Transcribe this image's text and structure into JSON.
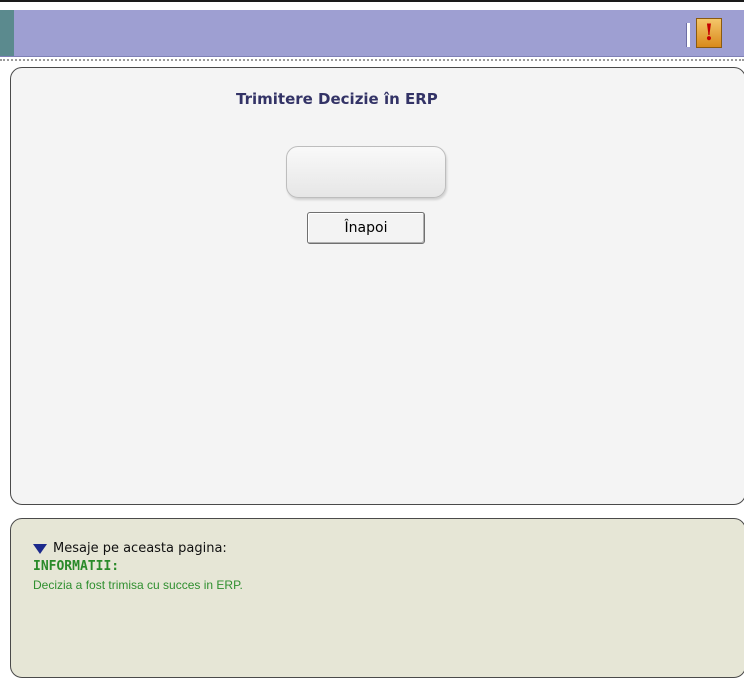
{
  "toolbar": {
    "alert_icon": "exclamation-icon",
    "alert_glyph": "!",
    "colors": {
      "bar": "#9e9fd2",
      "accent": "#5b8a8e"
    }
  },
  "main": {
    "title": "Trimitere Decizie în ERP",
    "back_button_label": "Înapoi"
  },
  "messages": {
    "header": "Mesaje pe aceasta pagina:",
    "section_title": "INFORMATII:",
    "info_text": "Decizia a fost trimisa cu succes in ERP.",
    "colors": {
      "panel_bg": "#e6e6d6",
      "info_text": "#2f8f2f"
    }
  }
}
